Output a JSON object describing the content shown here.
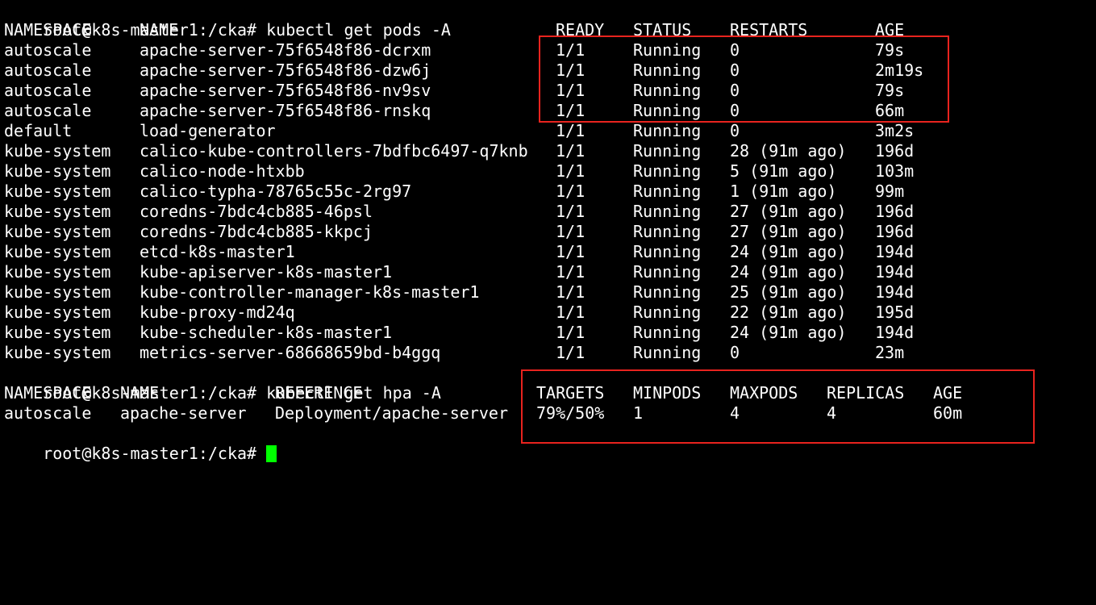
{
  "terminal": {
    "prompt": "root@k8s-master1:/cka#",
    "cmd_pods": "kubectl get pods -A",
    "cmd_hpa": "kubectl get hpa -A",
    "cursor_color": "#00ff00",
    "highlight_color": "#e8231e"
  },
  "pods": {
    "headers": {
      "namespace": "NAMESPACE",
      "name": "NAME",
      "ready": "READY",
      "status": "STATUS",
      "restarts": "RESTARTS",
      "age": "AGE"
    },
    "rows": [
      {
        "namespace": "autoscale",
        "name": "apache-server-75f6548f86-dcrxm",
        "ready": "1/1",
        "status": "Running",
        "restarts": "0",
        "age": "79s"
      },
      {
        "namespace": "autoscale",
        "name": "apache-server-75f6548f86-dzw6j",
        "ready": "1/1",
        "status": "Running",
        "restarts": "0",
        "age": "2m19s"
      },
      {
        "namespace": "autoscale",
        "name": "apache-server-75f6548f86-nv9sv",
        "ready": "1/1",
        "status": "Running",
        "restarts": "0",
        "age": "79s"
      },
      {
        "namespace": "autoscale",
        "name": "apache-server-75f6548f86-rnskq",
        "ready": "1/1",
        "status": "Running",
        "restarts": "0",
        "age": "66m"
      },
      {
        "namespace": "default",
        "name": "load-generator",
        "ready": "1/1",
        "status": "Running",
        "restarts": "0",
        "age": "3m2s"
      },
      {
        "namespace": "kube-system",
        "name": "calico-kube-controllers-7bdfbc6497-q7knb",
        "ready": "1/1",
        "status": "Running",
        "restarts": "28 (91m ago)",
        "age": "196d"
      },
      {
        "namespace": "kube-system",
        "name": "calico-node-htxbb",
        "ready": "1/1",
        "status": "Running",
        "restarts": "5 (91m ago)",
        "age": "103m"
      },
      {
        "namespace": "kube-system",
        "name": "calico-typha-78765c55c-2rg97",
        "ready": "1/1",
        "status": "Running",
        "restarts": "1 (91m ago)",
        "age": "99m"
      },
      {
        "namespace": "kube-system",
        "name": "coredns-7bdc4cb885-46psl",
        "ready": "1/1",
        "status": "Running",
        "restarts": "27 (91m ago)",
        "age": "196d"
      },
      {
        "namespace": "kube-system",
        "name": "coredns-7bdc4cb885-kkpcj",
        "ready": "1/1",
        "status": "Running",
        "restarts": "27 (91m ago)",
        "age": "196d"
      },
      {
        "namespace": "kube-system",
        "name": "etcd-k8s-master1",
        "ready": "1/1",
        "status": "Running",
        "restarts": "24 (91m ago)",
        "age": "194d"
      },
      {
        "namespace": "kube-system",
        "name": "kube-apiserver-k8s-master1",
        "ready": "1/1",
        "status": "Running",
        "restarts": "24 (91m ago)",
        "age": "194d"
      },
      {
        "namespace": "kube-system",
        "name": "kube-controller-manager-k8s-master1",
        "ready": "1/1",
        "status": "Running",
        "restarts": "25 (91m ago)",
        "age": "194d"
      },
      {
        "namespace": "kube-system",
        "name": "kube-proxy-md24q",
        "ready": "1/1",
        "status": "Running",
        "restarts": "22 (91m ago)",
        "age": "195d"
      },
      {
        "namespace": "kube-system",
        "name": "kube-scheduler-k8s-master1",
        "ready": "1/1",
        "status": "Running",
        "restarts": "24 (91m ago)",
        "age": "194d"
      },
      {
        "namespace": "kube-system",
        "name": "metrics-server-68668659bd-b4ggq",
        "ready": "1/1",
        "status": "Running",
        "restarts": "0",
        "age": "23m"
      }
    ]
  },
  "hpa": {
    "headers": {
      "namespace": "NAMESPACE",
      "name": "NAME",
      "reference": "REFERENCE",
      "targets": "TARGETS",
      "minpods": "MINPODS",
      "maxpods": "MAXPODS",
      "replicas": "REPLICAS",
      "age": "AGE"
    },
    "rows": [
      {
        "namespace": "autoscale",
        "name": "apache-server",
        "reference": "Deployment/apache-server",
        "targets": "79%/50%",
        "minpods": "1",
        "maxpods": "4",
        "replicas": "4",
        "age": "60m"
      }
    ]
  }
}
